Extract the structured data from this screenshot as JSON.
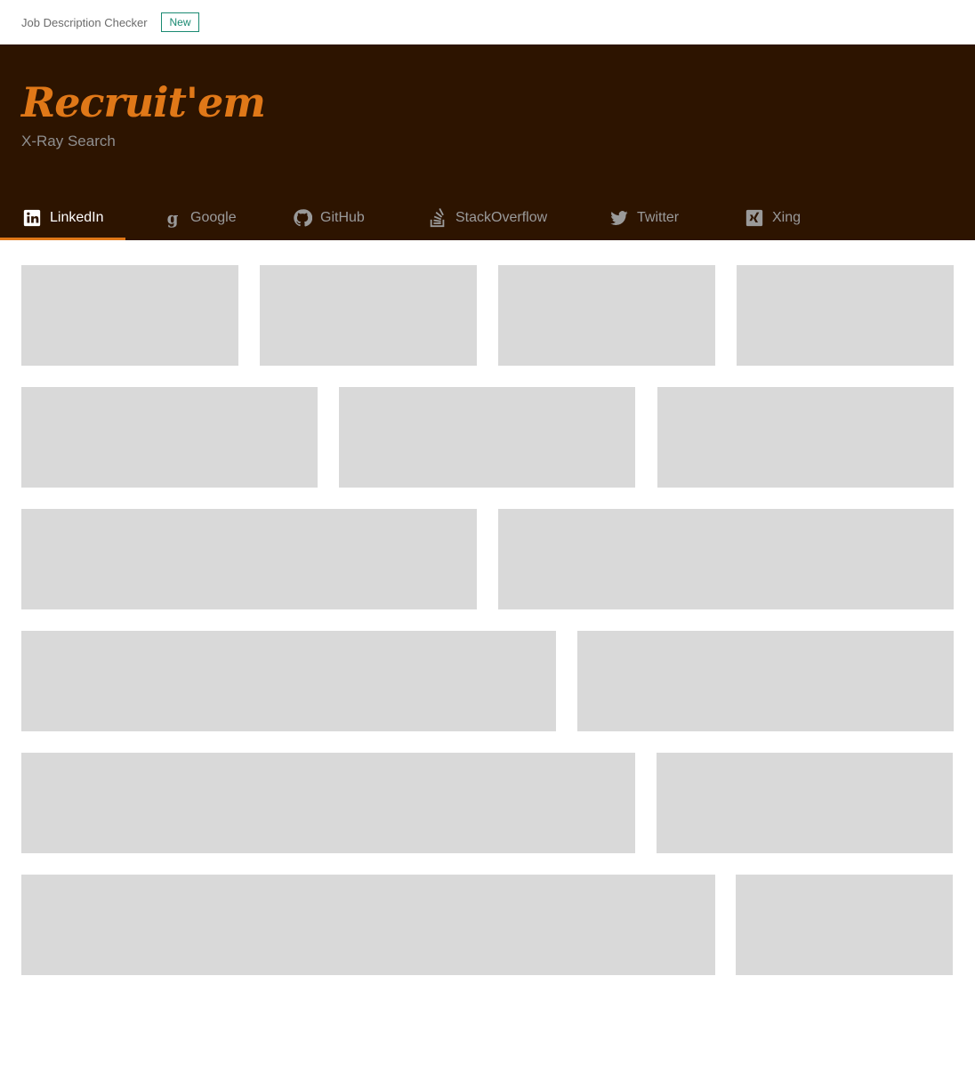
{
  "topbar": {
    "link_label": "Job Description Checker",
    "badge_label": "New",
    "badge_color": "#1a8a72"
  },
  "header": {
    "logo": "Recruit'em",
    "subtitle": "X-Ray Search",
    "background": "#2d1400",
    "accent": "#e07818"
  },
  "tabs": [
    {
      "label": "LinkedIn",
      "icon": "linkedin-icon",
      "active": true
    },
    {
      "label": "Google",
      "icon": "google-icon",
      "active": false
    },
    {
      "label": "GitHub",
      "icon": "github-icon",
      "active": false
    },
    {
      "label": "StackOverflow",
      "icon": "stackoverflow-icon",
      "active": false
    },
    {
      "label": "Twitter",
      "icon": "twitter-icon",
      "active": false
    },
    {
      "label": "Xing",
      "icon": "xing-icon",
      "active": false
    }
  ],
  "placeholder_color": "#d9d9d9"
}
